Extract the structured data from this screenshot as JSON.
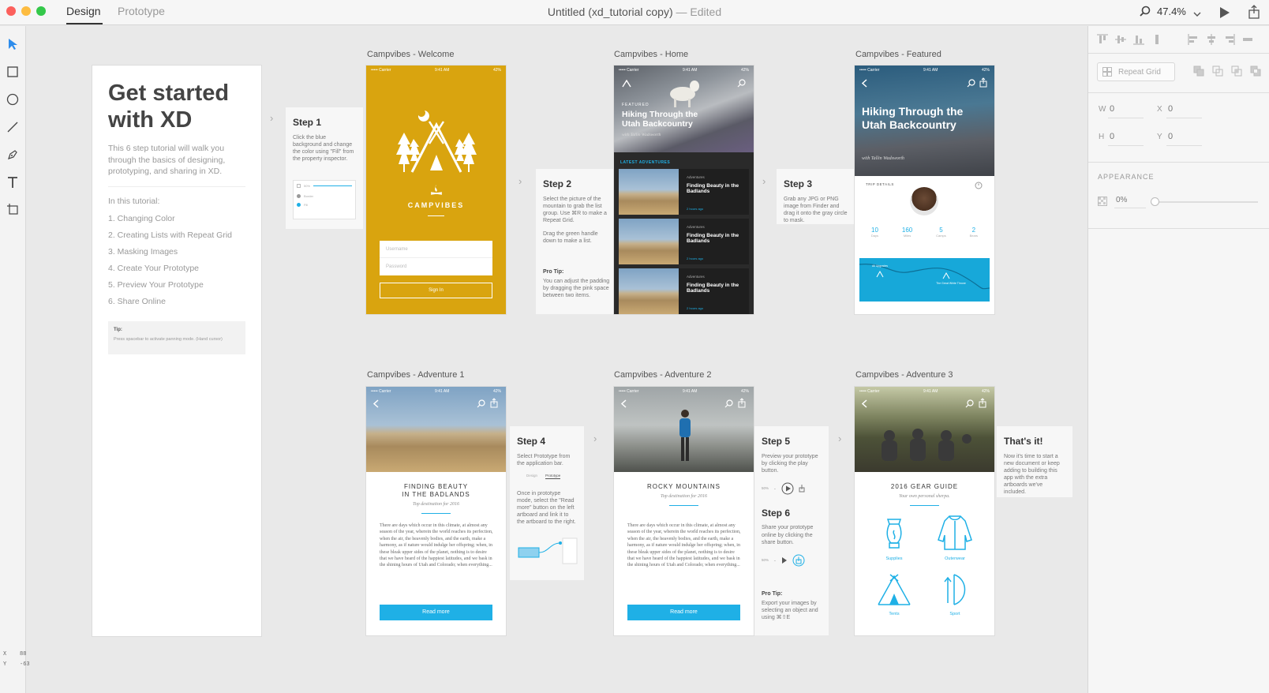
{
  "titlebar": {
    "tabs": {
      "design": "Design",
      "prototype": "Prototype"
    },
    "title": "Untitled (xd_tutorial copy)",
    "title_suffix": "— Edited",
    "zoom": "47.4%"
  },
  "toolbar": {
    "tools": [
      "select-tool",
      "rectangle-tool",
      "ellipse-tool",
      "line-tool",
      "pen-tool",
      "text-tool",
      "artboard-tool"
    ],
    "coord_x_label": "X",
    "coord_x": "88",
    "coord_y_label": "Y",
    "coord_y": "-63"
  },
  "inspector": {
    "repeat_grid": "Repeat Grid",
    "w_label": "W",
    "w": "0",
    "x_label": "X",
    "x": "0",
    "h_label": "H",
    "h": "0",
    "y_label": "Y",
    "y": "0",
    "appearance": "APPEARANCE",
    "opacity": "0%",
    "opacity_value": 0
  },
  "intro": {
    "title_line1": "Get started",
    "title_line2": "with XD",
    "desc": "This 6 step tutorial will walk you through the basics of designing, prototyping, and sharing in XD.",
    "in_tutorial": "In this tutorial:",
    "items": [
      "1. Changing Color",
      "2. Creating Lists with Repeat Grid",
      "3. Masking Images",
      "4. Create Your Prototype",
      "5. Preview Your Prototype",
      "6. Share Online"
    ],
    "tip_title": "Tip:",
    "tip_text": "Press spacebar to activate panning mode. (Hand cursor)"
  },
  "artboards": {
    "welcome": {
      "label": "Campvibes - Welcome",
      "carrier": "••••• Carrier",
      "time": "9:41 AM",
      "battery": "42%",
      "brand": "CAMPVIBES",
      "username": "Username",
      "password": "Password",
      "signin": "Sign In"
    },
    "home": {
      "label": "Campvibes - Home",
      "carrier": "••••• Carrier",
      "time": "9:41 AM",
      "battery": "42%",
      "featured": "FEATURED",
      "hero_title": "Hiking Through the Utah Backcountry",
      "hero_author": "with Tallin Wadsworth",
      "latest": "LATEST ADVENTURES",
      "cards": [
        {
          "tag": "Adventures",
          "title": "Finding Beauty in the Badlands",
          "meta": "2 hours ago"
        },
        {
          "tag": "Adventures",
          "title": "Finding Beauty in the Badlands",
          "meta": "2 hours ago"
        },
        {
          "tag": "Adventures",
          "title": "Finding Beauty in the Badlands",
          "meta": "2 hours ago"
        }
      ]
    },
    "featured": {
      "label": "Campvibes - Featured",
      "carrier": "••••• Carrier",
      "time": "9:41 AM",
      "battery": "42%",
      "title": "Hiking Through the Utah Backcountry",
      "author": "with Tallin Wadsworth",
      "trip_details": "TRIP DETAILS",
      "stats": [
        {
          "v": "10",
          "l": "Days"
        },
        {
          "v": "160",
          "l": "Miles"
        },
        {
          "v": "5",
          "l": "Camps"
        },
        {
          "v": "2",
          "l": "Bears"
        }
      ],
      "map_a": "All Upgrades",
      "map_b": "The Great White Throne"
    },
    "adv1": {
      "label": "Campvibes - Adventure 1",
      "carrier": "••••• Carrier",
      "time": "9:41 AM",
      "battery": "42%",
      "title_l1": "FINDING BEAUTY",
      "title_l2": "IN THE BADLANDS",
      "subtitle": "Top destination for 2016",
      "body": "There are days which occur in this climate, at almost any season of the year, wherein the world reaches its perfection, when the air, the heavenly bodies, and the earth, make a harmony, as if nature would indulge her offspring; when, in these bleak upper sides of the planet, nothing is to desire that we have heard of the happiest latitudes, and we bask in the shining hours of Utah and Colorado; when everything...",
      "read_more": "Read more"
    },
    "adv2": {
      "label": "Campvibes - Adventure 2",
      "carrier": "••••• Carrier",
      "time": "9:41 AM",
      "battery": "42%",
      "title": "ROCKY MOUNTAINS",
      "subtitle": "Top destination for 2016",
      "body": "There are days which occur in this climate, at almost any season of the year, wherein the world reaches its perfection, when the air, the heavenly bodies, and the earth, make a harmony, as if nature would indulge her offspring; when, in these bleak upper sides of the planet, nothing is to desire that we have heard of the happiest latitudes, and we bask in the shining hours of Utah and Colorado; when everything...",
      "read_more": "Read more"
    },
    "adv3": {
      "label": "Campvibes - Adventure 3",
      "carrier": "••••• Carrier",
      "time": "9:41 AM",
      "battery": "42%",
      "title": "2016 GEAR GUIDE",
      "subtitle": "Your own personal sherpa.",
      "gear": [
        "Supplies",
        "Outerwear",
        "Tents",
        "Sport"
      ]
    }
  },
  "steps": {
    "s1": {
      "title": "Step 1",
      "text": "Click the blue background and change the color using \"Fill\" from the property inspector.",
      "mini_a": "50%",
      "mini_b": "Border",
      "mini_c": "Fill"
    },
    "s2": {
      "title": "Step 2",
      "text": "Select the picture of the mountain to grab the list group. Use ⌘R to make a Repeat Grid.",
      "text2": "Drag the green handle down to make a list.",
      "pro": "Pro Tip:",
      "pro_text": "You can adjust the padding by dragging the pink space between two items."
    },
    "s3": {
      "title": "Step 3",
      "text": "Grab any JPG or PNG image from Finder and drag it onto the gray circle to mask."
    },
    "s4": {
      "title": "Step 4",
      "text": "Select Prototype from the application bar.",
      "mini_design": "Design",
      "mini_proto": "Prototype",
      "text2": "Once in prototype mode, select the \"Read more\" button on the left artboard and link it to the artboard to the right."
    },
    "s5": {
      "title": "Step 5",
      "text": "Preview your prototype by clicking the play button.",
      "zoom": "50%"
    },
    "s6": {
      "title": "Step 6",
      "text": "Share your prototype online by clicking the share button.",
      "zoom": "50%",
      "pro": "Pro Tip:",
      "pro_text": "Export your images by selecting an object and using ⌘⇧E"
    },
    "done": {
      "title": "That's it!",
      "text": "Now it's time to start a new document or keep adding to building this app with the extra artboards we've included."
    }
  },
  "colors": {
    "welcome_bg": "#d9a40f",
    "accent_blue": "#1fb0e6",
    "tool_active": "#2d8ceb",
    "card_dark": "#2c2c2c"
  }
}
